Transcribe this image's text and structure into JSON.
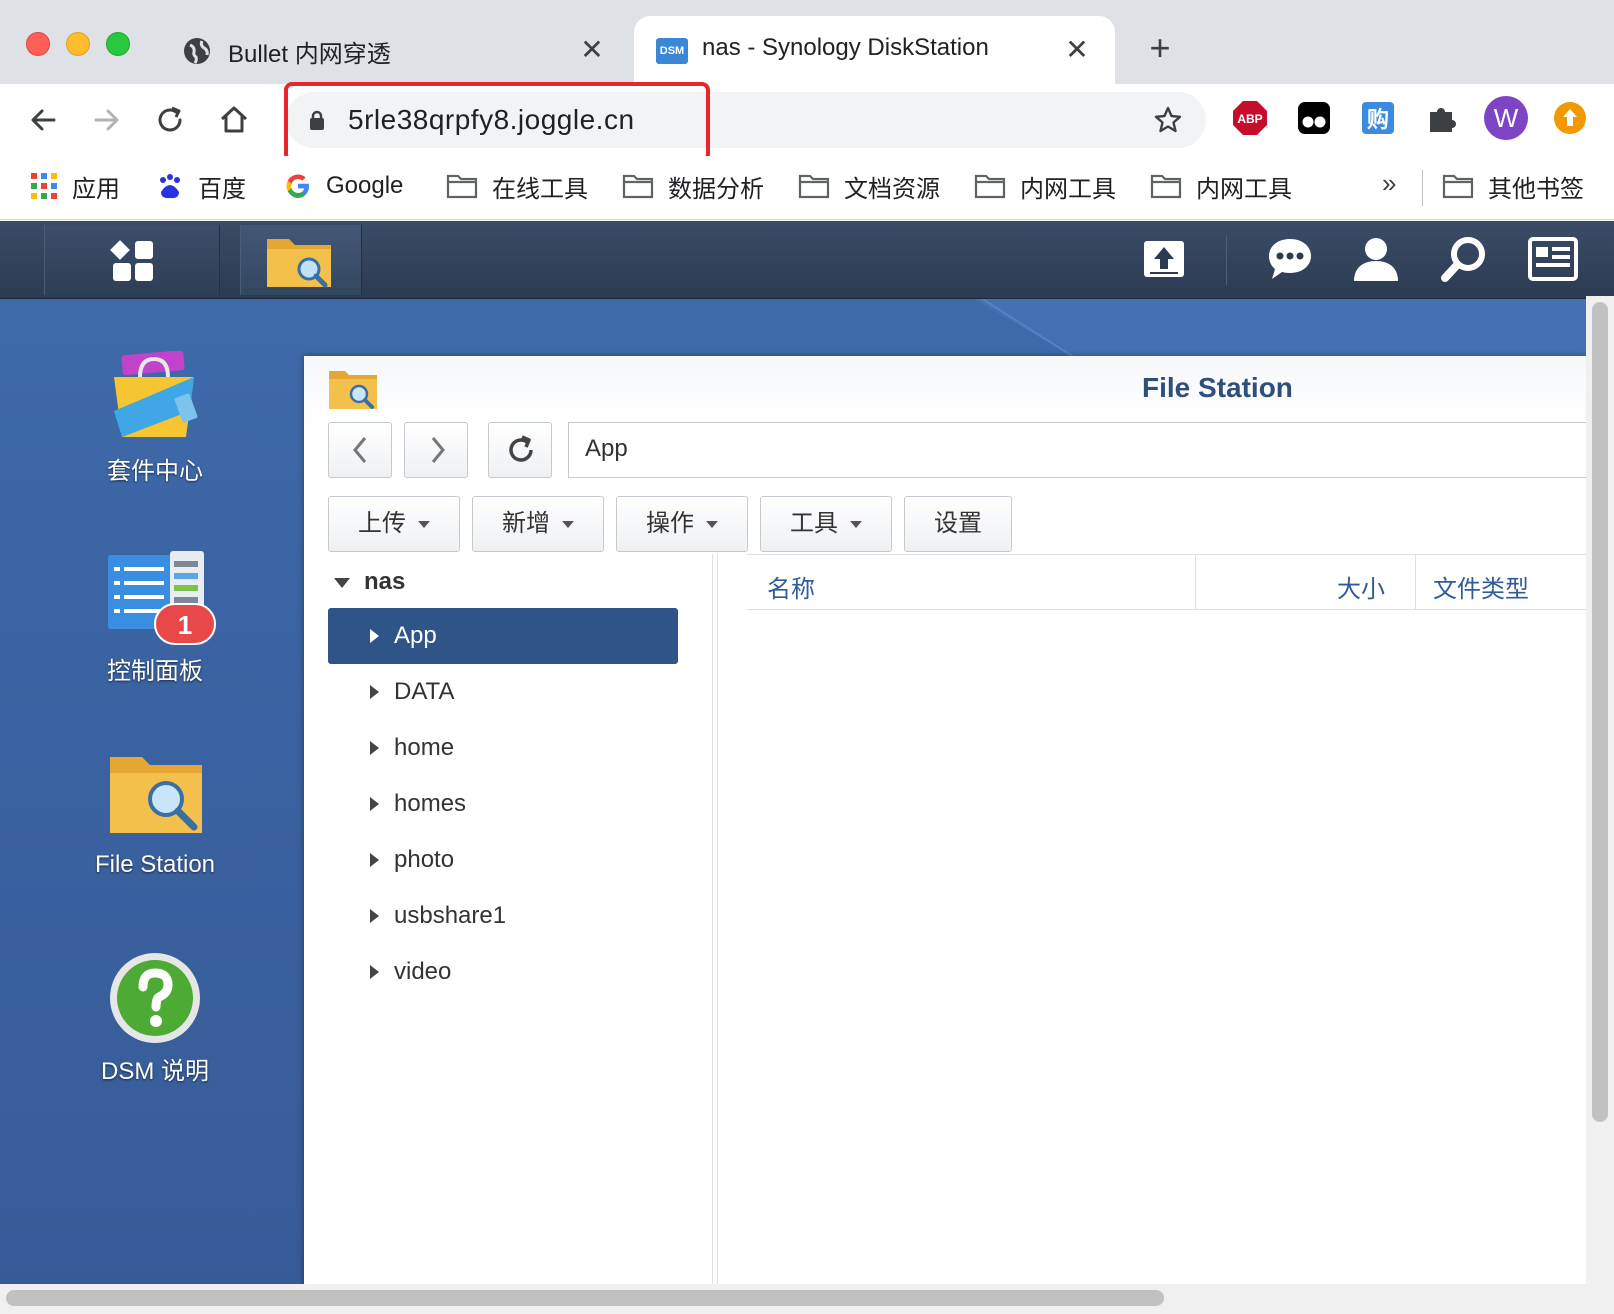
{
  "browser": {
    "tabs": [
      {
        "title": "Bullet 内网穿透",
        "favicon": "globe-icon",
        "active": false
      },
      {
        "title": "nas - Synology DiskStation",
        "favicon": "dsm-icon",
        "favicon_text": "DSM",
        "active": true
      }
    ],
    "close_glyph": "✕",
    "new_tab_glyph": "+",
    "url": "5rle38qrpfy8.joggle.cn",
    "avatar_letter": "W",
    "extensions": [
      "adblock-plus-icon",
      "tampermonkey-icon",
      "shopping-icon",
      "puzzle-extensions-icon",
      "profile-avatar",
      "update-icon"
    ],
    "abp_text": "ABP",
    "shop_text": "购",
    "bookmarks": [
      {
        "label": "应用",
        "icon": "apps-grid-icon"
      },
      {
        "label": "百度",
        "icon": "baidu-paw-icon"
      },
      {
        "label": "Google",
        "icon": "google-g-icon"
      },
      {
        "label": "在线工具",
        "icon": "folder-icon"
      },
      {
        "label": "数据分析",
        "icon": "folder-icon"
      },
      {
        "label": "文档资源",
        "icon": "folder-icon"
      },
      {
        "label": "内网工具",
        "icon": "folder-icon"
      },
      {
        "label": "内网工具",
        "icon": "folder-icon"
      }
    ],
    "bookmarks_more": "»",
    "other_bookmarks": "其他书签"
  },
  "dsm": {
    "desktop_icons": [
      {
        "label": "套件中心",
        "icon": "package-center-icon"
      },
      {
        "label": "控制面板",
        "icon": "control-panel-icon",
        "badge": "1"
      },
      {
        "label": "File Station",
        "icon": "file-station-icon"
      },
      {
        "label": "DSM 说明",
        "icon": "help-icon"
      }
    ],
    "taskbar_right_icons": [
      "upload-queue-icon",
      "notifications-chat-icon",
      "user-icon",
      "search-icon",
      "widgets-icon"
    ]
  },
  "file_station": {
    "title": "File Station",
    "path": "App",
    "toolbar_buttons": [
      {
        "label": "上传",
        "dropdown": true
      },
      {
        "label": "新增",
        "dropdown": true
      },
      {
        "label": "操作",
        "dropdown": true
      },
      {
        "label": "工具",
        "dropdown": true
      },
      {
        "label": "设置",
        "dropdown": false
      }
    ],
    "tree_root": "nas",
    "tree_items": [
      "App",
      "DATA",
      "home",
      "homes",
      "photo",
      "usbshare1",
      "video"
    ],
    "selected_item": "App",
    "columns": [
      "名称",
      "大小",
      "文件类型"
    ]
  },
  "colors": {
    "tab_strip": "#dee1e6",
    "dsm_taskbar": "#2c3b52",
    "dsm_desktop": "#3b65a3",
    "selection": "#2e5488",
    "header_text": "#2f5b9a",
    "url_highlight": "#e8252b"
  }
}
